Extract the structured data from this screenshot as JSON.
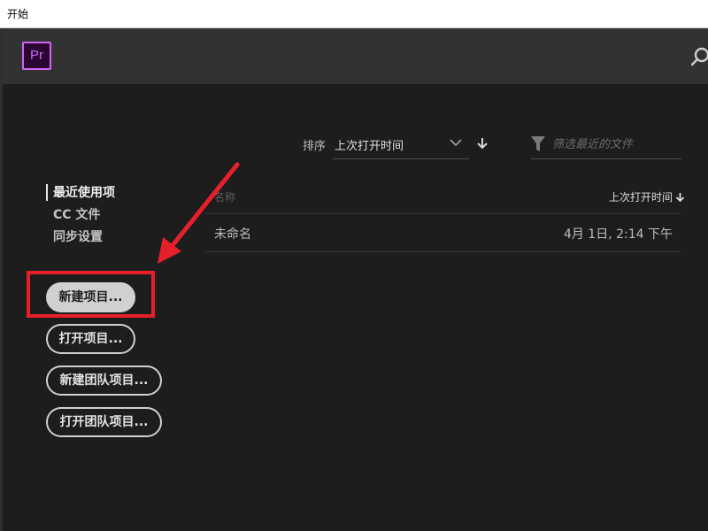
{
  "window": {
    "title": "开始"
  },
  "header": {
    "logo_text": "Pr",
    "search_icon": "search-icon"
  },
  "sort": {
    "label": "排序",
    "value": "上次打开时间"
  },
  "filter": {
    "placeholder": "筛选最近的文件"
  },
  "nav": {
    "items": [
      {
        "label": "最近使用项",
        "active": true
      },
      {
        "label": "CC 文件",
        "active": false
      },
      {
        "label": "同步设置",
        "active": false
      }
    ]
  },
  "buttons": {
    "new_project": "新建项目...",
    "open_project": "打开项目...",
    "new_team_project": "新建团队项目...",
    "open_team_project": "打开团队项目..."
  },
  "file_list": {
    "columns": {
      "name": "名称",
      "date": "上次打开时间"
    },
    "rows": [
      {
        "name": "未命名",
        "date": "4月 1日, 2:14 下午"
      }
    ]
  },
  "colors": {
    "accent_pr": "#d067f2",
    "annotation": "#e6202a",
    "background": "#1d1d1d",
    "header": "#323232"
  }
}
